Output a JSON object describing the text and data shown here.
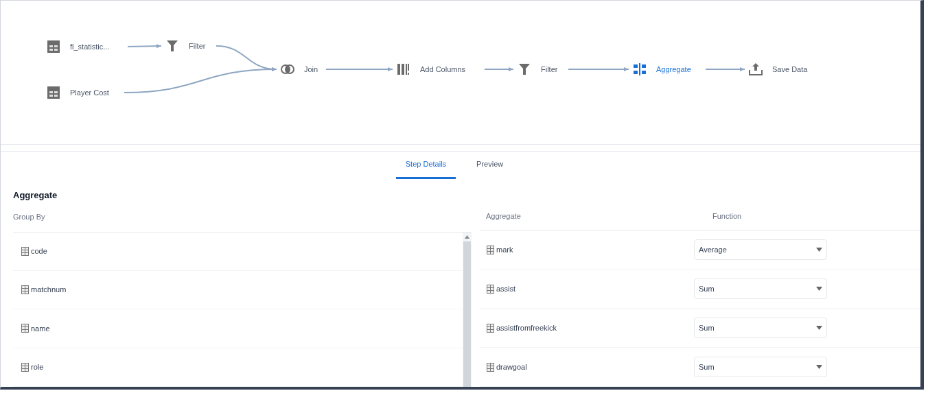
{
  "flow": {
    "nodes": [
      {
        "kind": "dataset",
        "label": "fl_statistic...",
        "selected": false
      },
      {
        "kind": "filter",
        "label": "Filter",
        "selected": false
      },
      {
        "kind": "dataset",
        "label": "Player Cost",
        "selected": false
      },
      {
        "kind": "join",
        "label": "Join",
        "selected": false
      },
      {
        "kind": "add_columns",
        "label": "Add Columns",
        "selected": false
      },
      {
        "kind": "filter",
        "label": "Filter",
        "selected": false
      },
      {
        "kind": "aggregate",
        "label": "Aggregate",
        "selected": true
      },
      {
        "kind": "save",
        "label": "Save Data",
        "selected": false
      }
    ]
  },
  "tabs": [
    {
      "label": "Step Details",
      "selected": true
    },
    {
      "label": "Preview",
      "selected": false
    }
  ],
  "step": {
    "title": "Aggregate",
    "group_by": {
      "heading": "Group By",
      "columns": [
        "code",
        "matchnum",
        "name",
        "role"
      ]
    },
    "aggregates": {
      "headings": [
        "Aggregate",
        "Function"
      ],
      "rows": [
        {
          "column": "mark",
          "function": "Average"
        },
        {
          "column": "assist",
          "function": "Sum"
        },
        {
          "column": "assistfromfreekick",
          "function": "Sum"
        },
        {
          "column": "drawgoal",
          "function": "Sum"
        }
      ]
    }
  }
}
